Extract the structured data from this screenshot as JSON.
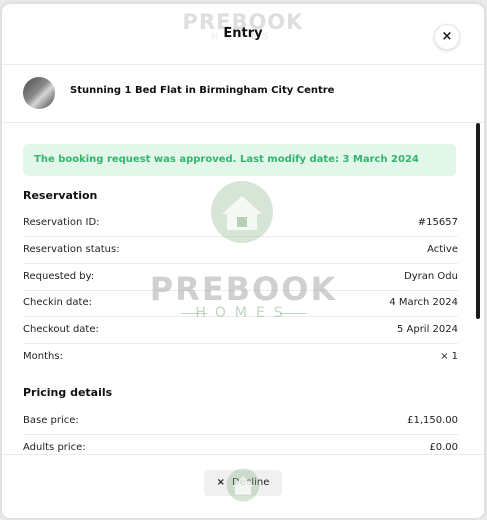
{
  "brand": {
    "name": "PREBOOK",
    "sub": "HOMES"
  },
  "modal": {
    "title": "Entry",
    "close_glyph": "×"
  },
  "property": {
    "title": "Stunning 1 Bed Flat in Birmingham City Centre"
  },
  "alert": {
    "text": "The booking request was approved. Last modify date: 3 March 2024"
  },
  "reservation": {
    "heading": "Reservation",
    "rows": [
      {
        "label": "Reservation ID:",
        "value": "#15657"
      },
      {
        "label": "Reservation status:",
        "value": "Active"
      },
      {
        "label": "Requested by:",
        "value": "Dyran Odu"
      },
      {
        "label": "Checkin date:",
        "value": "4 March 2024"
      },
      {
        "label": "Checkout date:",
        "value": "5 April 2024"
      },
      {
        "label": "Months:",
        "value": "1"
      }
    ]
  },
  "pricing": {
    "heading": "Pricing details",
    "rows": [
      {
        "label": "Base price:",
        "value": "£1,150.00"
      },
      {
        "label": "Adults price:",
        "value": "£0.00"
      }
    ]
  },
  "footer": {
    "decline_label": "Decline",
    "decline_glyph": "×"
  },
  "colors": {
    "alert_bg": "#e3f6ea",
    "alert_text": "#34b56b",
    "brand_green": "#8cb48c"
  }
}
